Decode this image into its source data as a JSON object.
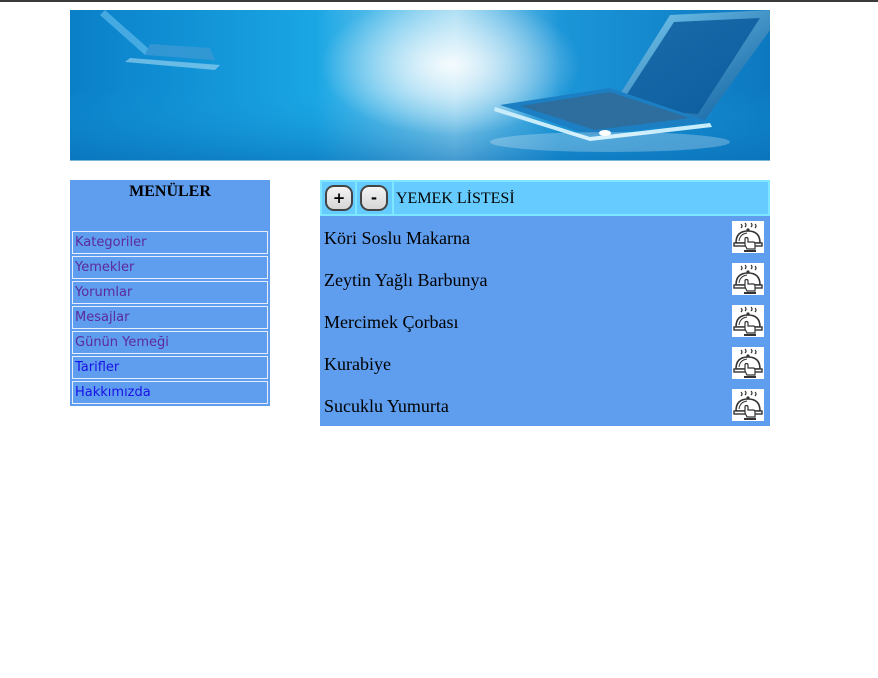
{
  "banner": {
    "image_name": "laptop-banner-image",
    "colors": {
      "primary": "#0a88d4",
      "light": "#e4f4fb"
    }
  },
  "menu": {
    "title": "MENÜLER",
    "items": [
      {
        "label": "Kategoriler",
        "visited": true
      },
      {
        "label": "Yemekler",
        "visited": true
      },
      {
        "label": "Yorumlar",
        "visited": true
      },
      {
        "label": "Mesajlar",
        "visited": true
      },
      {
        "label": "Günün Yemeği",
        "visited": true
      },
      {
        "label": "Tarifler",
        "visited": false
      },
      {
        "label": "Hakkımızda",
        "visited": false
      }
    ],
    "colors": {
      "background": "#5f9dee",
      "visited_link": "#5b2a9c",
      "link": "#1a12e6"
    }
  },
  "food_list": {
    "header": {
      "plus_label": "+",
      "minus_label": "-",
      "title": "YEMEK LİSTESİ"
    },
    "items": [
      {
        "name": "Köri Soslu Makarna",
        "icon": "serving-dish-icon"
      },
      {
        "name": "Zeytin Yağlı Barbunya",
        "icon": "serving-dish-icon"
      },
      {
        "name": "Mercimek Çorbası",
        "icon": "serving-dish-icon"
      },
      {
        "name": "Kurabiye",
        "icon": "serving-dish-icon"
      },
      {
        "name": "Sucuklu Yumurta",
        "icon": "serving-dish-icon"
      }
    ],
    "colors": {
      "background": "#5f9dee",
      "header": "#66ccff"
    }
  }
}
